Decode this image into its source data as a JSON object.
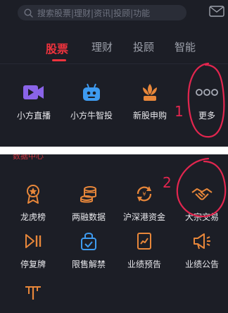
{
  "search": {
    "placeholder": "搜索股票|理财|资讯|投顾|功能"
  },
  "tabs": [
    {
      "label": "股票",
      "active": true
    },
    {
      "label": "理财"
    },
    {
      "label": "投顾"
    },
    {
      "label": "智能"
    }
  ],
  "quick_items": [
    {
      "label": "小方直播",
      "icon": "video-camera-icon"
    },
    {
      "label": "小方牛智投",
      "icon": "robot-icon"
    },
    {
      "label": "新股申购",
      "icon": "lotus-icon"
    },
    {
      "label": "更多",
      "icon": "more-dots-icon"
    }
  ],
  "section_label": "数据中心",
  "data_items": [
    {
      "label": "龙虎榜",
      "icon": "medal-icon"
    },
    {
      "label": "两融数据",
      "icon": "coin-stack-icon"
    },
    {
      "label": "沪深港资金",
      "icon": "exchange-arrows-icon"
    },
    {
      "label": "大宗交易",
      "icon": "handshake-icon"
    },
    {
      "label": "停复牌",
      "icon": "play-pause-icon"
    },
    {
      "label": "限售解禁",
      "icon": "unlock-bag-icon"
    },
    {
      "label": "业绩预告",
      "icon": "report-chart-icon"
    },
    {
      "label": "业绩公告",
      "icon": "megaphone-icon"
    },
    {
      "label": "",
      "icon": "scale-icon"
    }
  ],
  "annotations": {
    "first": "1",
    "second": "2"
  },
  "colors": {
    "background": "#1c1e26",
    "accent": "#f0333d",
    "icon_orange": "#e8873a",
    "annotation": "#e2264f"
  }
}
